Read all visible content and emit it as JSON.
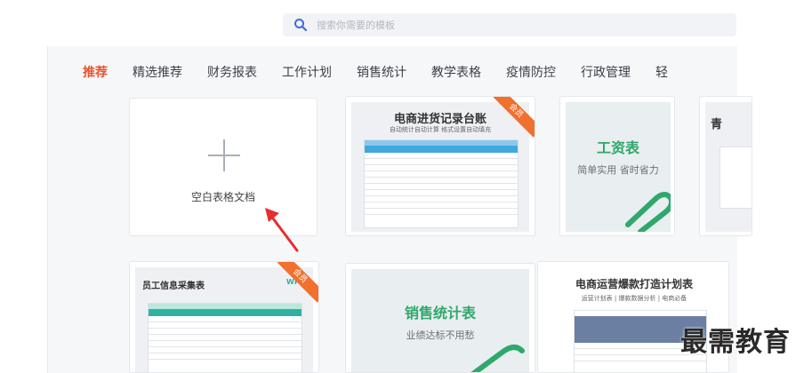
{
  "search": {
    "placeholder": "搜索你需要的模板"
  },
  "tabs": [
    {
      "label": "推荐",
      "active": true
    },
    {
      "label": "精选推荐"
    },
    {
      "label": "财务报表"
    },
    {
      "label": "工作计划"
    },
    {
      "label": "销售统计"
    },
    {
      "label": "教学表格"
    },
    {
      "label": "疫情防控"
    },
    {
      "label": "行政管理"
    },
    {
      "label": "轻"
    }
  ],
  "cards": {
    "blank": {
      "label": "空白表格文档"
    },
    "purchase": {
      "title": "电商进货记录台账",
      "subtitle": "自动统计自动计算 格式设置自动填充",
      "badge": "会员"
    },
    "salary": {
      "title": "工资表",
      "subtitle": "简单实用 省时省力"
    },
    "partial": {
      "title": "青"
    },
    "employee": {
      "title": "员工信息采集表",
      "brand": "WPS",
      "badge": "会员"
    },
    "sales": {
      "title": "销售统计表",
      "subtitle": "业绩达标不用愁"
    },
    "ecommerce": {
      "title": "电商运营爆款打造计划表",
      "subtitle": "运营计划表 | 爆款数据分析 | 电商必备"
    }
  },
  "watermark": "最需教育",
  "colors": {
    "accent": "#e8542f",
    "badge": "#f0702e",
    "green": "#2fa86b",
    "blue": "#3fa9dc",
    "teal": "#2fb3a0"
  }
}
